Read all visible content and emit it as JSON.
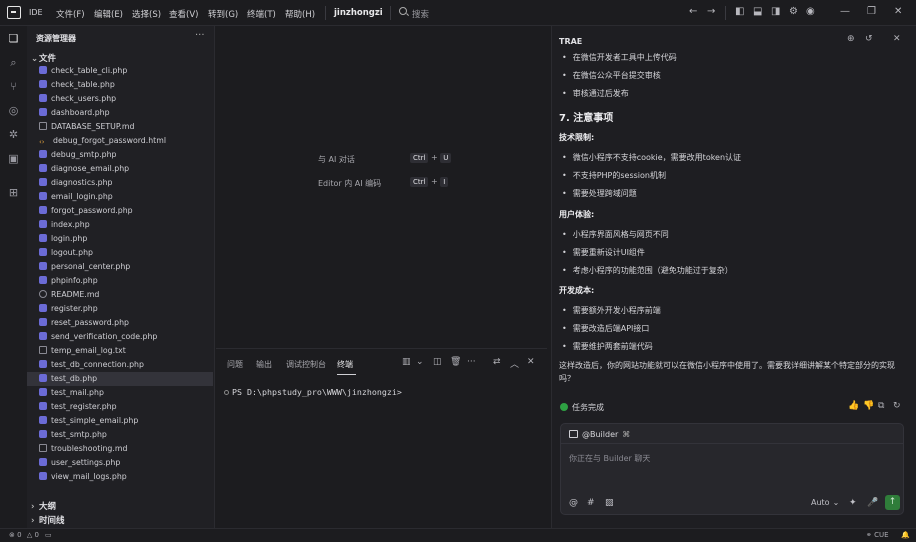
{
  "titlebar": {
    "ide": "IDE",
    "menus": [
      "文件(F)",
      "编辑(E)",
      "选择(S)",
      "查看(V)",
      "转到(G)",
      "终端(T)",
      "帮助(H)"
    ],
    "workspace": "jinzhongzi",
    "search_placeholder": "搜索"
  },
  "sidebar": {
    "title": "资源管理器",
    "section_files": "文件",
    "files": [
      {
        "name": "check_table_cli.php",
        "type": "php"
      },
      {
        "name": "check_table.php",
        "type": "php"
      },
      {
        "name": "check_users.php",
        "type": "php"
      },
      {
        "name": "dashboard.php",
        "type": "php"
      },
      {
        "name": "DATABASE_SETUP.md",
        "type": "md"
      },
      {
        "name": "debug_forgot_password.html",
        "type": "html"
      },
      {
        "name": "debug_smtp.php",
        "type": "php"
      },
      {
        "name": "diagnose_email.php",
        "type": "php"
      },
      {
        "name": "diagnostics.php",
        "type": "php"
      },
      {
        "name": "email_login.php",
        "type": "php"
      },
      {
        "name": "forgot_password.php",
        "type": "php"
      },
      {
        "name": "index.php",
        "type": "php"
      },
      {
        "name": "login.php",
        "type": "php"
      },
      {
        "name": "logout.php",
        "type": "php"
      },
      {
        "name": "personal_center.php",
        "type": "php"
      },
      {
        "name": "phpinfo.php",
        "type": "php"
      },
      {
        "name": "README.md",
        "type": "readme"
      },
      {
        "name": "register.php",
        "type": "php"
      },
      {
        "name": "reset_password.php",
        "type": "php"
      },
      {
        "name": "send_verification_code.php",
        "type": "php"
      },
      {
        "name": "temp_email_log.txt",
        "type": "txt"
      },
      {
        "name": "test_db_connection.php",
        "type": "php"
      },
      {
        "name": "test_db.php",
        "type": "php",
        "selected": true
      },
      {
        "name": "test_mail.php",
        "type": "php"
      },
      {
        "name": "test_register.php",
        "type": "php"
      },
      {
        "name": "test_simple_email.php",
        "type": "php"
      },
      {
        "name": "test_smtp.php",
        "type": "php"
      },
      {
        "name": "troubleshooting.md",
        "type": "md"
      },
      {
        "name": "user_settings.php",
        "type": "php"
      },
      {
        "name": "view_mail_logs.php",
        "type": "php"
      }
    ],
    "section_outline": "大纲",
    "section_timeline": "时间线"
  },
  "editor": {
    "hint1_label": "与 AI 对话",
    "hint1_keys": [
      "Ctrl",
      "+",
      "U"
    ],
    "hint2_label": "Editor 内 AI 编码",
    "hint2_keys": [
      "Ctrl",
      "+",
      "I"
    ]
  },
  "panel": {
    "tabs": [
      "问题",
      "输出",
      "调试控制台",
      "终端"
    ],
    "active_tab": "终端",
    "prompt": "PS D:\\phpstudy_pro\\WWW\\jinzhongzi>"
  },
  "chat": {
    "title": "TRAE",
    "top_bullets": [
      "在微信开发者工具中上传代码",
      "在微信公众平台提交审核",
      "审核通过后发布"
    ],
    "heading": "7. 注意事项",
    "group1_title": "技术限制:",
    "group1": [
      "微信小程序不支持cookie，需要改用token认证",
      "不支持PHP的session机制",
      "需要处理跨域问题"
    ],
    "group2_title": "用户体验:",
    "group2": [
      "小程序界面风格与网页不同",
      "需要重新设计UI组件",
      "考虑小程序的功能范围（避免功能过于复杂）"
    ],
    "group3_title": "开发成本:",
    "group3": [
      "需要额外开发小程序前端",
      "需要改造后端API接口",
      "需要维护两套前端代码"
    ],
    "closing": "这样改造后，你的网站功能就可以在微信小程序中使用了。需要我详细讲解某个特定部分的实现吗？",
    "task_done": "任务完成",
    "builder_label": "@Builder",
    "input_placeholder": "你正在与 Builder 聊天",
    "mode": "Auto"
  },
  "status": {
    "errors": "0",
    "warnings": "0",
    "right_label": "CUE"
  },
  "colors": {
    "background": "#1c1c1f",
    "sidebar": "#202024",
    "accent_green": "#2ea043",
    "php_icon": "#6b6bd6"
  }
}
